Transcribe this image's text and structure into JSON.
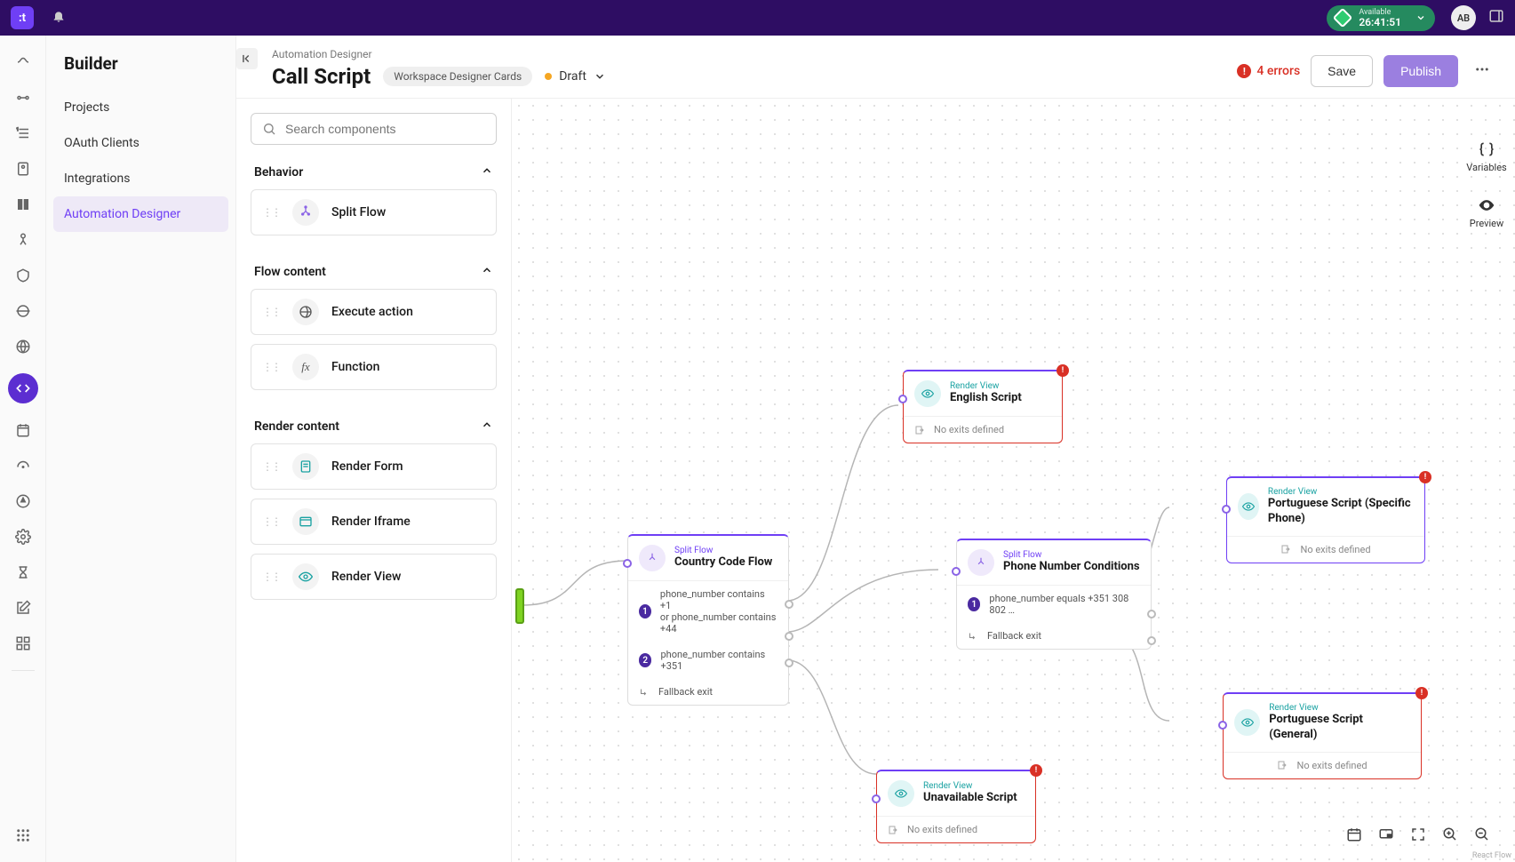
{
  "topbar": {
    "logo_text": ":t",
    "status_label": "Available",
    "status_time": "26:41:51",
    "avatar": "AB"
  },
  "nav": {
    "title": "Builder",
    "items": [
      "Projects",
      "OAuth Clients",
      "Integrations",
      "Automation Designer"
    ]
  },
  "header": {
    "breadcrumb": "Automation Designer",
    "title": "Call Script",
    "chip": "Workspace Designer Cards",
    "status": "Draft",
    "errors": "4 errors",
    "save": "Save",
    "publish": "Publish"
  },
  "components": {
    "search_placeholder": "Search components",
    "sections": {
      "behavior": {
        "title": "Behavior",
        "items": [
          "Split Flow"
        ]
      },
      "flow": {
        "title": "Flow content",
        "items": [
          "Execute action",
          "Function"
        ]
      },
      "render": {
        "title": "Render content",
        "items": [
          "Render Form",
          "Render Iframe",
          "Render View"
        ]
      }
    }
  },
  "right_tools": {
    "variables": "Variables",
    "preview": "Preview"
  },
  "nodes": {
    "country": {
      "type": "Split Flow",
      "title": "Country Code Flow",
      "cond1a": "phone_number contains +1",
      "cond1b": "or phone_number contains +44",
      "cond2": "phone_number contains +351",
      "fallback": "Fallback exit"
    },
    "phone": {
      "type": "Split Flow",
      "title": "Phone Number Conditions",
      "cond1": "phone_number equals +351 308 802 …",
      "fallback": "Fallback exit"
    },
    "english": {
      "type": "Render View",
      "title": "English Script",
      "noexit": "No exits defined"
    },
    "unavailable": {
      "type": "Render View",
      "title": "Unavailable Script",
      "noexit": "No exits defined"
    },
    "pt_specific": {
      "type": "Render View",
      "title": "Portuguese Script (Specific Phone)",
      "noexit": "No exits defined"
    },
    "pt_general": {
      "type": "Render View",
      "title": "Portuguese Script (General)",
      "noexit": "No exits defined"
    }
  },
  "footer": {
    "attribution": "React Flow"
  }
}
